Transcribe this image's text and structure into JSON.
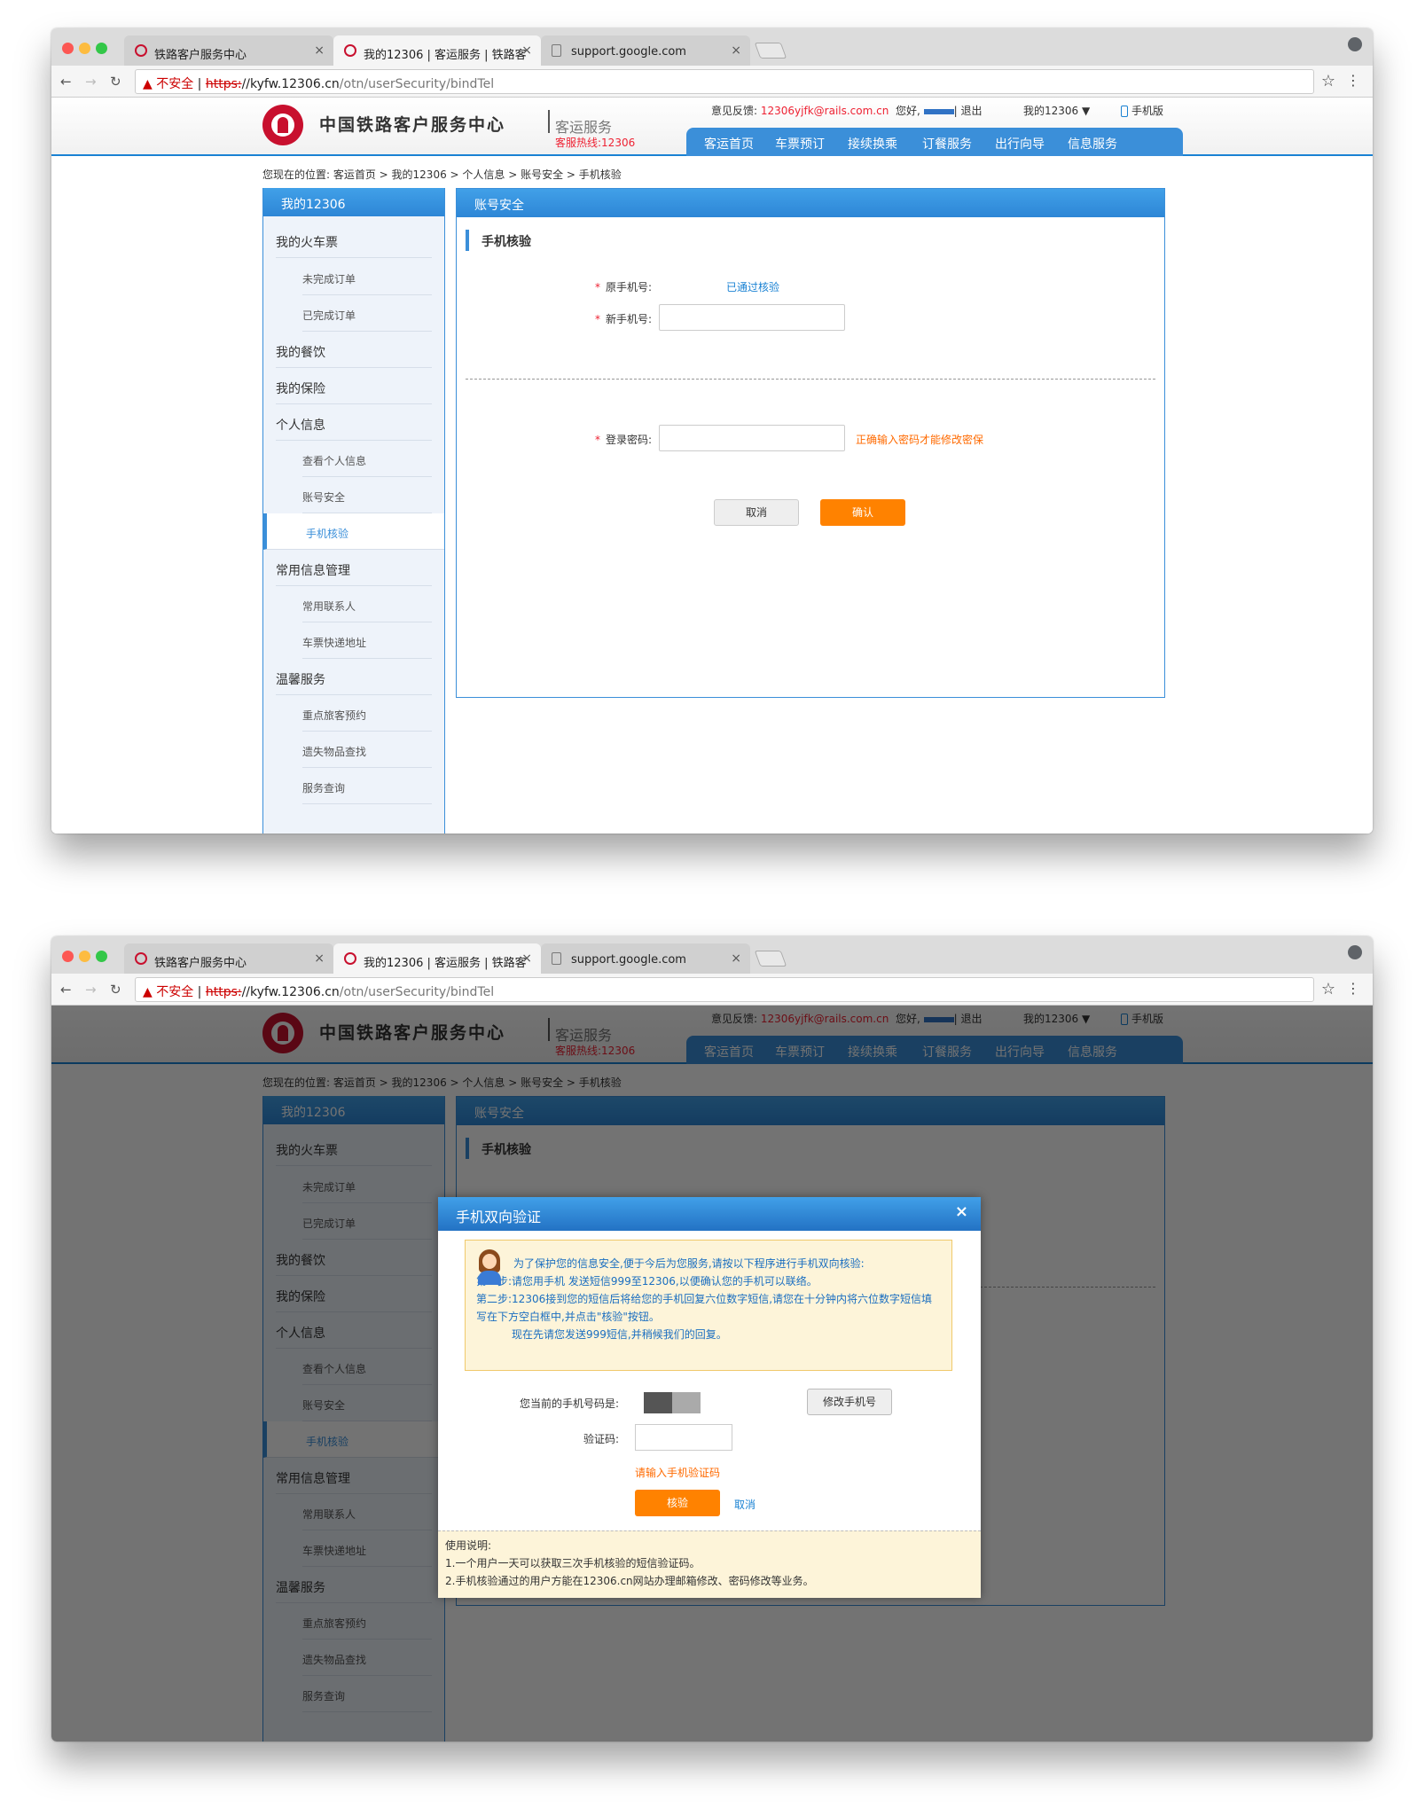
{
  "browser": {
    "tabs": [
      {
        "title": "铁路客户服务中心",
        "close": "×"
      },
      {
        "title": "我的12306 | 客运服务 | 铁路客",
        "close": "×"
      },
      {
        "title": "support.google.com",
        "close": "×"
      }
    ],
    "url_warning": "▲ 不安全",
    "url_scheme": "https:",
    "url_domain": "//kyfw.12306.cn",
    "url_path": "/otn/userSecurity/bindTel"
  },
  "header": {
    "site_name": "中国铁路客户服务中心",
    "site_sub": "客运服务",
    "hotline": "客服热线:12306",
    "feedback_label": "意见反馈:",
    "feedback_mail": "12306yjfk@rails.com.cn",
    "greeting": "您好,",
    "logout": "| 退出",
    "my12306": "我的12306",
    "mobile": "手机版",
    "nav": [
      "客运首页",
      "车票预订",
      "接续换乘",
      "订餐服务",
      "出行向导",
      "信息服务"
    ]
  },
  "breadcrumb": "您现在的位置: 客运首页 > 我的12306 > 个人信息 > 账号安全 > 手机核验",
  "sidebar": {
    "title": "我的12306",
    "items": [
      {
        "label": "我的火车票",
        "level": "top"
      },
      {
        "label": "未完成订单",
        "level": "sub"
      },
      {
        "label": "已完成订单",
        "level": "sub"
      },
      {
        "label": "我的餐饮",
        "level": "top"
      },
      {
        "label": "我的保险",
        "level": "top"
      },
      {
        "label": "个人信息",
        "level": "top"
      },
      {
        "label": "查看个人信息",
        "level": "sub"
      },
      {
        "label": "账号安全",
        "level": "sub"
      },
      {
        "label": "手机核验",
        "level": "active"
      },
      {
        "label": "常用信息管理",
        "level": "top"
      },
      {
        "label": "常用联系人",
        "level": "sub"
      },
      {
        "label": "车票快递地址",
        "level": "sub"
      },
      {
        "label": "温馨服务",
        "level": "top"
      },
      {
        "label": "重点旅客预约",
        "level": "sub"
      },
      {
        "label": "遗失物品查找",
        "level": "sub"
      },
      {
        "label": "服务查询",
        "level": "sub"
      }
    ]
  },
  "content": {
    "header": "账号安全",
    "title": "手机核验",
    "req_mark": "*",
    "old_phone_label": "原手机号:",
    "old_phone_status": "已通过核验",
    "new_phone_label": "新手机号:",
    "password_label": "登录密码:",
    "password_note": "正确输入密码才能修改密保",
    "cancel": "取消",
    "confirm": "确认"
  },
  "dialog": {
    "title": "手机双向验证",
    "close": "×",
    "intro": "为了保护您的信息安全,便于今后为您服务,请按以下程序进行手机双向核验:",
    "step1": "第一步:请您用手机                    发送短信999至12306,以便确认您的手机可以联络。",
    "step2": "第二步:12306接到您的短信后将给您的手机回复六位数字短信,请您在十分钟内将六位数字短信填写在下方空白框中,并点击\"核验\"按钮。",
    "now": "现在先请您发送999短信,并稍候我们的回复。",
    "phone_label": "您当前的手机号码是:",
    "modify_button": "修改手机号",
    "code_label": "验证码:",
    "code_tip": "请输入手机验证码",
    "verify_button": "核验",
    "cancel_link": "取消",
    "usage_title": "使用说明:",
    "usage_1": "1.一个用户一天可以获取三次手机核验的短信验证码。",
    "usage_2": "2.手机核验通过的用户方能在12306.cn网站办理邮箱修改、密码修改等业务。"
  },
  "colors": {
    "accent": "#3b8fd9",
    "orange": "#ff8200",
    "brand_red": "#c8102e"
  }
}
